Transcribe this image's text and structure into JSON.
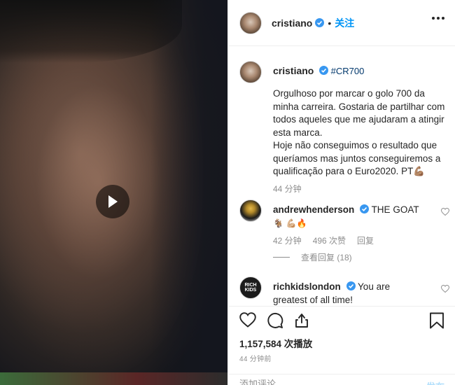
{
  "post": {
    "username": "cristiano",
    "dot": "•",
    "follow_label": "关注"
  },
  "caption": {
    "username": "cristiano",
    "hashtag": "#CR700",
    "body": "Orgulhoso por marcar o golo 700 da minha carreira. Gostaria de partilhar com todos aqueles que me ajudaram a atingir esta marca.\nHoje não conseguimos o resultado que queríamos mas juntos conseguiremos a qualificação para o Euro2020. PT💪🏽",
    "time": "44 分钟"
  },
  "comments": [
    {
      "username": "andrewhenderson",
      "text": "THE GOAT",
      "emoji_line": "🐐 💪🏼🔥",
      "time": "42 分钟",
      "likes": "496 次赞",
      "reply": "回复",
      "view_replies": "查看回复 (18)"
    },
    {
      "username": "richkidslondon",
      "text": "You are greatest of all time!",
      "avatar_text": "RICH KIDS"
    }
  ],
  "footer": {
    "views": "1,157,584 次播放",
    "posted": "44 分钟前",
    "comment_placeholder": "添加评论...",
    "post_label": "发布"
  },
  "colors": {
    "accent": "#0095f6",
    "verified": "#3897f0",
    "hashtag": "#00376b",
    "muted": "#8e8e8e"
  },
  "icons": [
    "play-icon",
    "verified-badge-icon",
    "more-options-icon",
    "heart-icon",
    "comment-icon",
    "share-icon",
    "bookmark-icon"
  ]
}
